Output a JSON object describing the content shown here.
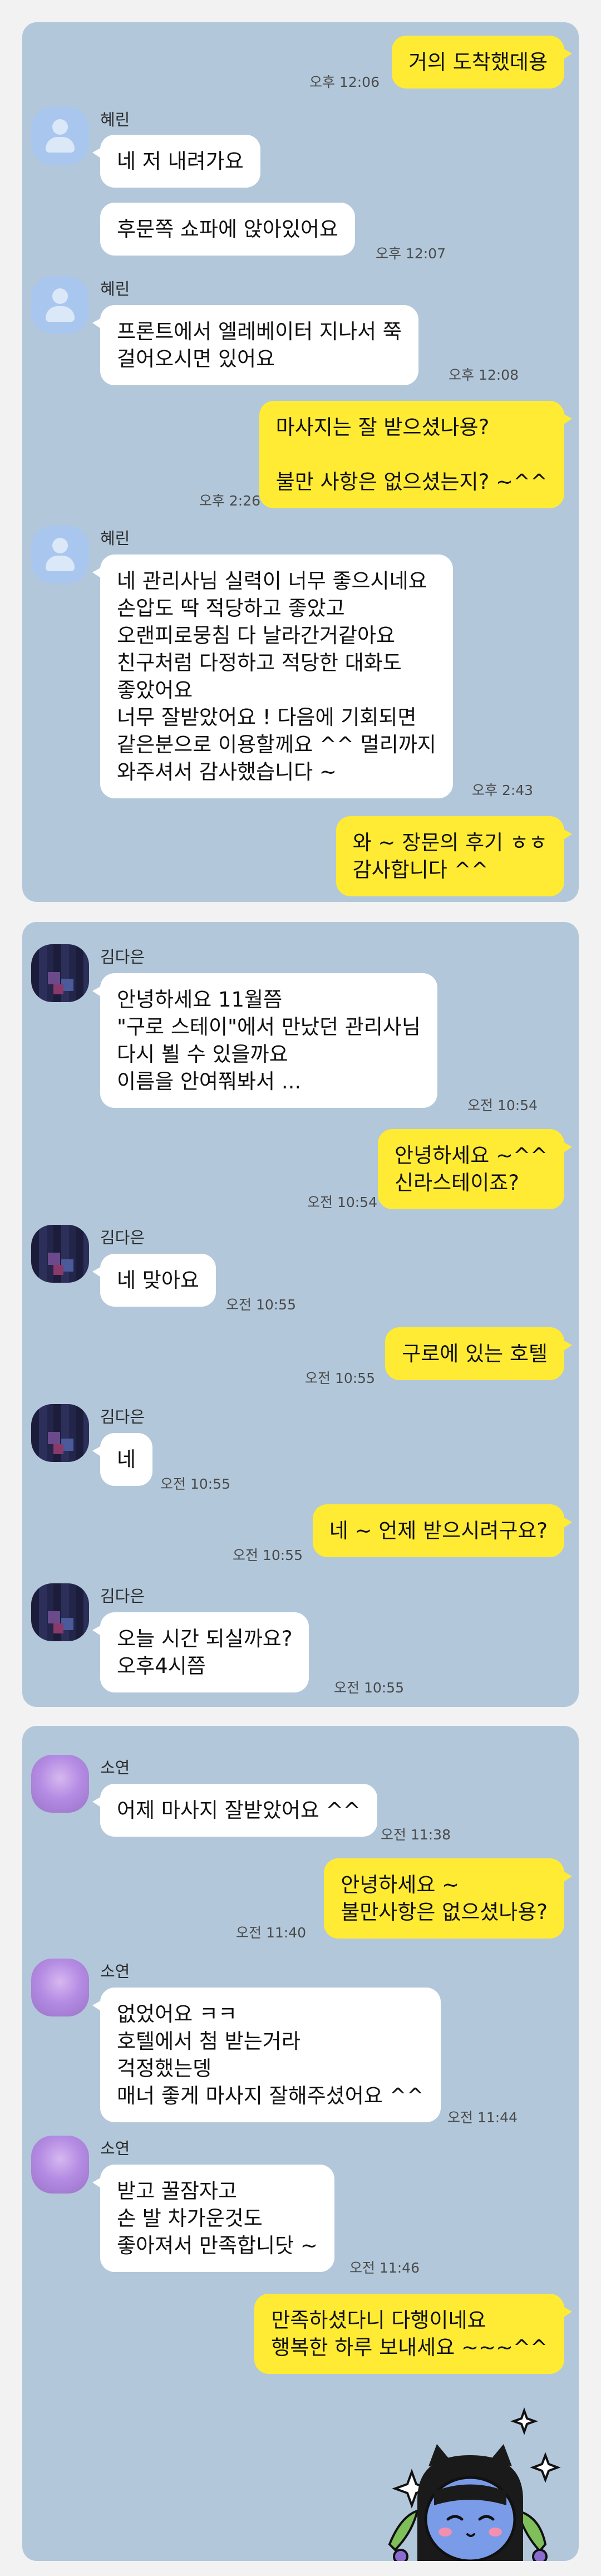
{
  "chat1": {
    "msg1": {
      "text": "거의 도착했데용",
      "time": "오후 12:06"
    },
    "sender1": "혜린",
    "msg2": {
      "text": "네 저 내려가요"
    },
    "msg3": {
      "text": "후문쪽 쇼파에 앉아있어요",
      "time": "오후 12:07"
    },
    "sender2": "혜린",
    "msg4": {
      "text": "프론트에서 엘레베이터 지나서 쭉\n걸어오시면 있어요",
      "time": "오후 12:08"
    },
    "msg5": {
      "text": "마사지는 잘 받으셨나용?\n\n불만 사항은 없으셨는지? ~^^",
      "time": "오후 2:26"
    },
    "sender3": "혜린",
    "msg6": {
      "text": "네 관리사님 실력이 너무 좋으시네요\n손압도 딱 적당하고 좋았고\n오랜피로뭉침 다 날라간거같아요\n친구처럼 다정하고 적당한 대화도\n좋았어요\n너무 잘받았어요 ! 다음에 기회되면\n같은분으로 이용할께요 ^^ 멀리까지\n와주셔서 감사했습니다 ~",
      "time": "오후 2:43"
    },
    "msg7": {
      "text": "와 ~ 장문의 후기 ㅎㅎ\n감사합니다 ^^"
    }
  },
  "chat2": {
    "sender1": "김다은",
    "msg1": {
      "text": "안녕하세요 11월쯤\n\"구로 스테이\"에서 만났던 관리사님\n다시 뵐 수 있을까요\n이름을 안여쭤봐서 ...",
      "time": "오전 10:54"
    },
    "msg2": {
      "text": "안녕하세요 ~^^\n신라스테이죠?",
      "time": "오전 10:54"
    },
    "sender2": "김다은",
    "msg3": {
      "text": "네 맞아요",
      "time": "오전 10:55"
    },
    "msg4": {
      "text": "구로에 있는 호텔",
      "time": "오전 10:55"
    },
    "sender3": "김다은",
    "msg5": {
      "text": "네",
      "time": "오전 10:55"
    },
    "msg6": {
      "text": "네 ~ 언제 받으시려구요?",
      "time": "오전 10:55"
    },
    "sender4": "김다은",
    "msg7": {
      "text": "오늘  시간 되실까요?\n오후4시쯤",
      "time": "오전 10:55"
    }
  },
  "chat3": {
    "sender1": "소연",
    "msg1": {
      "text": "어제 마사지 잘받았어요 ^^",
      "time": "오전 11:38"
    },
    "msg2": {
      "text": "안녕하세요 ~\n불만사항은 없으셨나용?",
      "time": "오전 11:40"
    },
    "sender2": "소연",
    "msg3": {
      "text": "없었어요 ㅋㅋ\n호텔에서 첨 받는거라\n걱정했는뎅\n매너 좋게 마사지 잘해주셨어요 ^^",
      "time": "오전 11:44"
    },
    "sender3": "소연",
    "msg4": {
      "text": "받고 꿀잠자고\n손 발 차가운것도\n좋아져서 만족합니닷 ~",
      "time": "오전 11:46"
    },
    "msg5": {
      "text": "만족하셨다니 다행이네요\n행복한 하루 보내세요 ~~~^^"
    }
  },
  "colors": {
    "chat_bg": "#b2c7da",
    "my_bubble": "#ffeb33",
    "their_bubble": "#ffffff"
  },
  "sticker": "cat-character-sticker"
}
